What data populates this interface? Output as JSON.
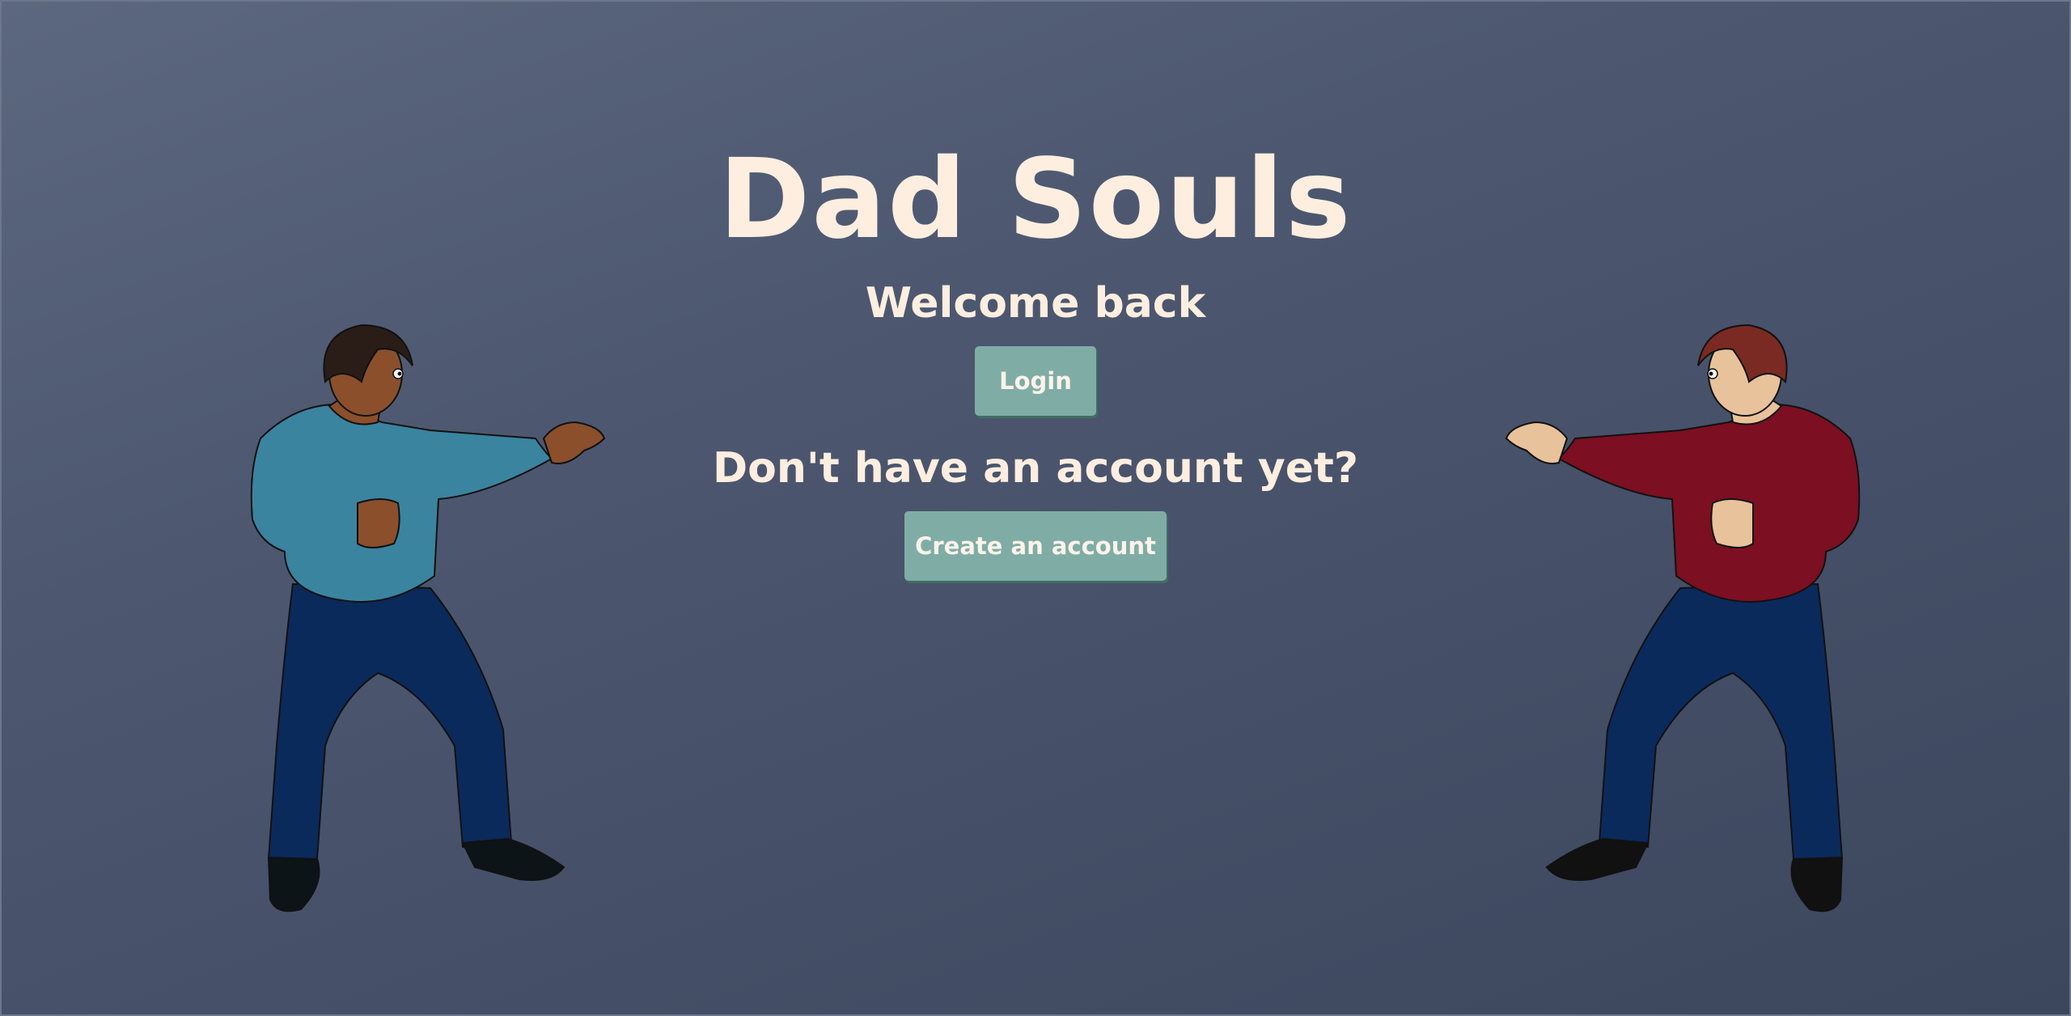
{
  "app": {
    "title": "Dad Souls"
  },
  "hero": {
    "welcome": "Welcome back",
    "login_label": "Login",
    "question": "Don't have an account yet?",
    "create_label": "Create an account"
  },
  "illustrations": {
    "left": "fighter-blue-shirt",
    "right": "fighter-red-shirt"
  },
  "colors": {
    "button": "#7fada6",
    "text": "#fdeee0",
    "left_shirt": "#3a84a0",
    "right_shirt": "#7c0f21",
    "pants": "#0b2a5c"
  }
}
